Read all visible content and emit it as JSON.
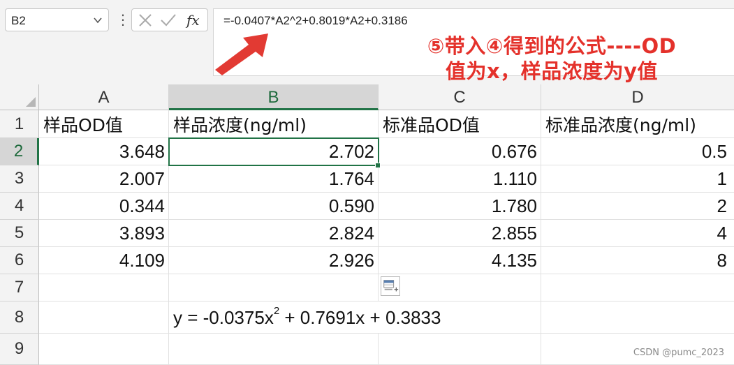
{
  "formula_bar": {
    "name_box": "B2",
    "more_glyph": "⋮",
    "fx_label": "fx",
    "formula": "=-0.0407*A2^2+0.8019*A2+0.3186",
    "cancel_icon": "x-icon",
    "enter_icon": "check-icon"
  },
  "annotation": {
    "line1": "⑤带入④得到的公式----OD",
    "line2": "值为x，样品浓度为y值",
    "color": "#e4312b"
  },
  "columns": [
    "A",
    "B",
    "C",
    "D"
  ],
  "rows": [
    "1",
    "2",
    "3",
    "4",
    "5",
    "6",
    "7",
    "8",
    "9"
  ],
  "headers": {
    "A": "样品OD值",
    "B": "样品浓度(ng/ml)",
    "C": "标准品OD值",
    "D": "标准品浓度(ng/ml)"
  },
  "data": [
    {
      "A": "3.648",
      "B": "2.702",
      "C": "0.676",
      "D": "0.5"
    },
    {
      "A": "2.007",
      "B": "1.764",
      "C": "1.110",
      "D": "1"
    },
    {
      "A": "0.344",
      "B": "0.590",
      "C": "1.780",
      "D": "2"
    },
    {
      "A": "3.893",
      "B": "2.824",
      "C": "2.855",
      "D": "4"
    },
    {
      "A": "4.109",
      "B": "2.926",
      "C": "4.135",
      "D": "8"
    }
  ],
  "equation": {
    "prefix": "y = -0.0375x",
    "exponent": "2",
    "suffix": " + 0.7691x + 0.3833"
  },
  "selected_cell": "B2",
  "accent_color": "#217346",
  "watermark": "CSDN @pumc_2023"
}
